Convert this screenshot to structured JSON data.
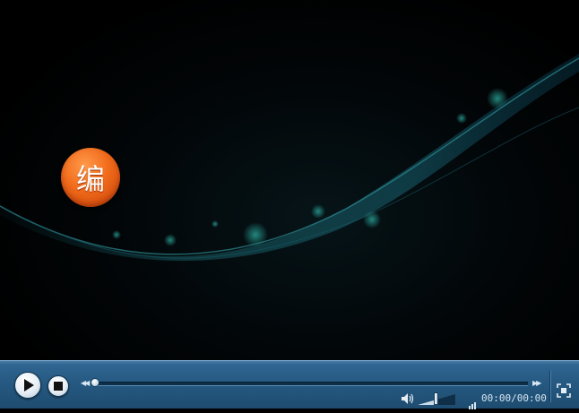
{
  "player": {
    "edit_badge_label": "编",
    "time_display": "00:00/00:00",
    "seek_progress": 0,
    "volume_level": 0.5
  },
  "colors": {
    "control_bar": "#255880",
    "badge": "#f06a1a",
    "glow": "#1f8c8c"
  },
  "icons": {
    "play": "play-icon",
    "stop": "stop-icon",
    "rewind": "rewind-icon",
    "forward": "fast-forward-icon",
    "volume": "speaker-icon",
    "signal": "signal-bars-icon",
    "fullscreen": "fullscreen-icon"
  }
}
